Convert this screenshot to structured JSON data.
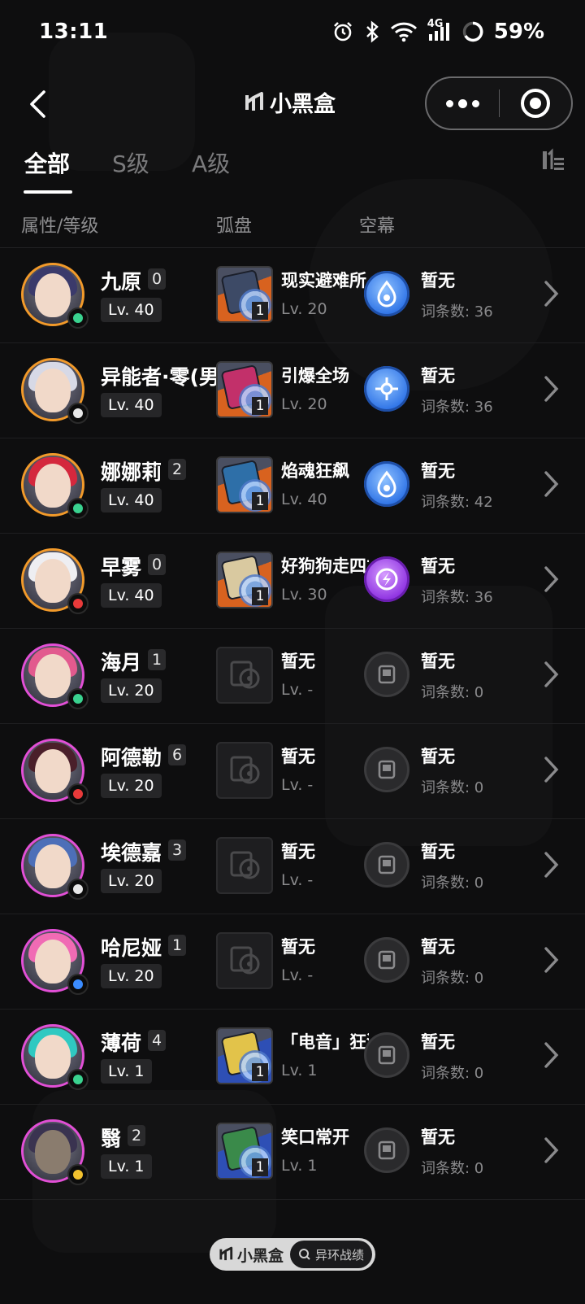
{
  "status_bar": {
    "time": "13:11",
    "network": "4G",
    "battery": "59%"
  },
  "nav": {
    "title": "小黑盒"
  },
  "tabs": [
    {
      "label": "全部",
      "active": true
    },
    {
      "label": "S级",
      "active": false
    },
    {
      "label": "A级",
      "active": false
    }
  ],
  "columns": {
    "attr_level": "属性/等级",
    "disc": "弧盘",
    "sky": "空幕"
  },
  "rows": [
    {
      "name": "九原",
      "rank": "0",
      "level": "Lv. 40",
      "disc_name": "现实避难所",
      "disc_level": "Lv. 20",
      "disc_count": "1",
      "sky_name": "暂无",
      "sky_count": "词条数: 36"
    },
    {
      "name": "异能者·零(男",
      "rank": "",
      "level": "Lv. 40",
      "disc_name": "引爆全场",
      "disc_level": "Lv. 20",
      "disc_count": "1",
      "sky_name": "暂无",
      "sky_count": "词条数: 36"
    },
    {
      "name": "娜娜莉",
      "rank": "2",
      "level": "Lv. 40",
      "disc_name": "焰魂狂飙",
      "disc_level": "Lv. 40",
      "disc_count": "1",
      "sky_name": "暂无",
      "sky_count": "词条数: 42"
    },
    {
      "name": "早雾",
      "rank": "0",
      "level": "Lv. 40",
      "disc_name": "好狗狗走四方",
      "disc_level": "Lv. 30",
      "disc_count": "1",
      "sky_name": "暂无",
      "sky_count": "词条数: 36"
    },
    {
      "name": "海月",
      "rank": "1",
      "level": "Lv. 20",
      "disc_name": "暂无",
      "disc_level": "Lv. -",
      "disc_count": "",
      "sky_name": "暂无",
      "sky_count": "词条数: 0"
    },
    {
      "name": "阿德勒",
      "rank": "6",
      "level": "Lv. 20",
      "disc_name": "暂无",
      "disc_level": "Lv. -",
      "disc_count": "",
      "sky_name": "暂无",
      "sky_count": "词条数: 0"
    },
    {
      "name": "埃德嘉",
      "rank": "3",
      "level": "Lv. 20",
      "disc_name": "暂无",
      "disc_level": "Lv. -",
      "disc_count": "",
      "sky_name": "暂无",
      "sky_count": "词条数: 0"
    },
    {
      "name": "哈尼娅",
      "rank": "1",
      "level": "Lv. 20",
      "disc_name": "暂无",
      "disc_level": "Lv. -",
      "disc_count": "",
      "sky_name": "暂无",
      "sky_count": "词条数: 0"
    },
    {
      "name": "薄荷",
      "rank": "4",
      "level": "Lv. 1",
      "disc_name": "「电音」狂潮",
      "disc_level": "Lv. 1",
      "disc_count": "1",
      "sky_name": "暂无",
      "sky_count": "词条数: 0"
    },
    {
      "name": "翳",
      "rank": "2",
      "level": "Lv. 1",
      "disc_name": "笑口常开",
      "disc_level": "Lv. 1",
      "disc_count": "1",
      "sky_name": "暂无",
      "sky_count": "词条数: 0"
    }
  ],
  "footer": {
    "brand": "小黑盒",
    "game": "异环战绩"
  }
}
